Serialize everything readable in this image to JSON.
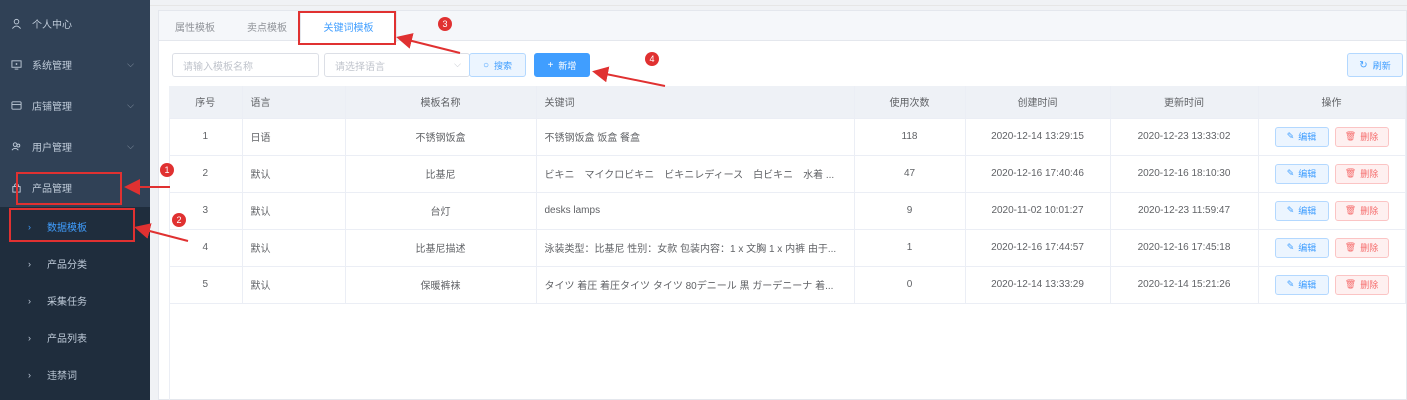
{
  "sidebar": {
    "items": [
      {
        "label": "个人中心",
        "icon": "user-icon"
      },
      {
        "label": "系统管理",
        "icon": "monitor-icon",
        "arrow": "⌵"
      },
      {
        "label": "店铺管理",
        "icon": "store-icon",
        "arrow": "⌵"
      },
      {
        "label": "用户管理",
        "icon": "users-icon",
        "arrow": "⌵"
      },
      {
        "label": "产品管理",
        "icon": "lock-icon"
      }
    ],
    "subitems": [
      {
        "label": "数据模板",
        "active": true
      },
      {
        "label": "产品分类"
      },
      {
        "label": "采集任务"
      },
      {
        "label": "产品列表"
      },
      {
        "label": "违禁词"
      }
    ]
  },
  "tabs": [
    {
      "label": "属性模板"
    },
    {
      "label": "卖点模板"
    },
    {
      "label": "关键词模板",
      "active": true
    }
  ],
  "toolbar": {
    "name_placeholder": "请输入模板名称",
    "lang_placeholder": "请选择语言",
    "search_label": "搜索",
    "add_label": "新增",
    "refresh_label": "刷新"
  },
  "table": {
    "headers": {
      "index": "序号",
      "lang": "语言",
      "name": "模板名称",
      "keywords": "关键词",
      "count": "使用次数",
      "created": "创建时间",
      "updated": "更新时间",
      "ops": "操作"
    },
    "edit_label": "编辑",
    "delete_label": "删除",
    "rows": [
      {
        "index": "1",
        "lang": "日语",
        "name": "不锈钢饭盒",
        "keywords": "不锈钢饭盒 饭盒 餐盒",
        "count": "118",
        "created": "2020-12-14 13:29:15",
        "updated": "2020-12-23 13:33:02"
      },
      {
        "index": "2",
        "lang": "默认",
        "name": "比基尼",
        "keywords": "ビキニ　マイクロビキニ　ビキニレディース　白ビキニ　水着 ...",
        "count": "47",
        "created": "2020-12-16 17:40:46",
        "updated": "2020-12-16 18:10:30"
      },
      {
        "index": "3",
        "lang": "默认",
        "name": "台灯",
        "keywords": "desks lamps",
        "count": "9",
        "created": "2020-11-02 10:01:27",
        "updated": "2020-12-23 11:59:47"
      },
      {
        "index": "4",
        "lang": "默认",
        "name": "比基尼描述",
        "keywords": "泳装类型：比基尼 性别：女款 包装内容：1 x 文胸 1 x 内裤 由于...",
        "count": "1",
        "created": "2020-12-16 17:44:57",
        "updated": "2020-12-16 17:45:18"
      },
      {
        "index": "5",
        "lang": "默认",
        "name": "保暖裤袜",
        "keywords": "タイツ 着圧 着圧タイツ タイツ 80デニール 黒 ガーデニーナ 着...",
        "count": "0",
        "created": "2020-12-14 13:33:29",
        "updated": "2020-12-14 15:21:26"
      }
    ]
  },
  "annotations": {
    "n1": "1",
    "n2": "2",
    "n3": "3",
    "n4": "4",
    "color": "#e03131"
  }
}
